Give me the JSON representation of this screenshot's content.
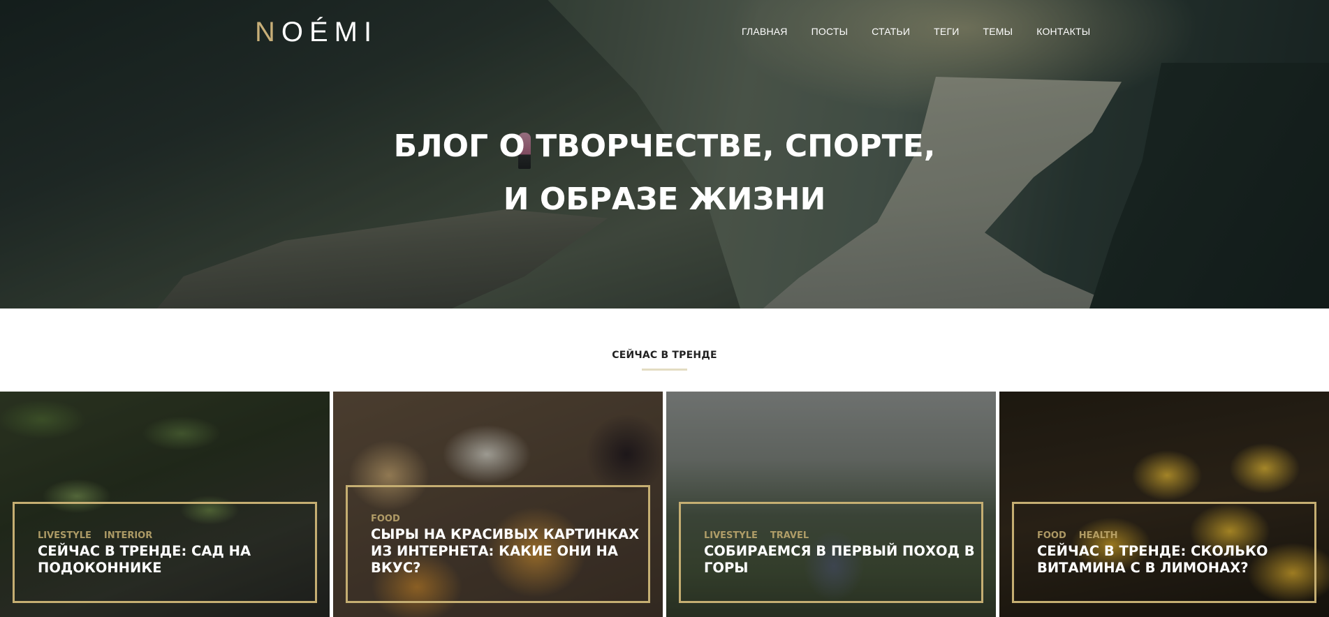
{
  "brand": {
    "logo_first": "N",
    "logo_rest": "OÉMI"
  },
  "nav": {
    "items": [
      {
        "label": "ГЛАВНАЯ"
      },
      {
        "label": "ПОСТЫ"
      },
      {
        "label": "СТАТЬИ"
      },
      {
        "label": "ТЕГИ"
      },
      {
        "label": "ТЕМЫ"
      },
      {
        "label": "КОНТАКТЫ"
      }
    ]
  },
  "hero": {
    "title_line1": "БЛОГ О ТВОРЧЕСТВЕ, СПОРТЕ,",
    "title_line2": "И ОБРАЗЕ ЖИЗНИ"
  },
  "trending": {
    "heading": "СЕЙЧАС В ТРЕНДЕ",
    "cards": [
      {
        "tags": [
          "LIVESTYLE",
          "INTERIOR"
        ],
        "title": "СЕЙЧАС В ТРЕНДЕ: САД НА ПОДОКОННИКЕ"
      },
      {
        "tags": [
          "FOOD"
        ],
        "title": "СЫРЫ НА КРАСИВЫХ КАРТИНКАХ ИЗ ИНТЕРНЕТА: КАКИЕ ОНИ НА ВКУС?"
      },
      {
        "tags": [
          "LIVESTYLE",
          "TRAVEL"
        ],
        "title": "СОБИРАЕМСЯ В ПЕРВЫЙ ПОХОД В ГОРЫ"
      },
      {
        "tags": [
          "FOOD",
          "HEALTH"
        ],
        "title": "СЕЙЧАС В ТРЕНДЕ: СКОЛЬКО ВИТАМИНА С В ЛИМОНАХ?"
      }
    ]
  },
  "colors": {
    "accent": "#c5ae72",
    "text_dark": "#222222",
    "underline": "#e3dcc2"
  }
}
